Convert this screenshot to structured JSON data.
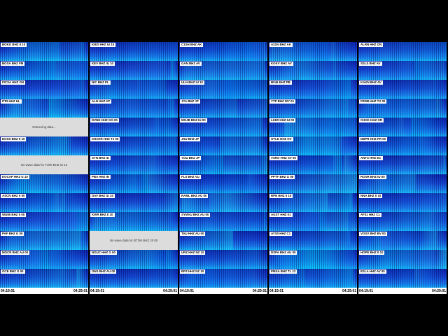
{
  "colors": {
    "background": "#000000",
    "spec_low": "#0d1fa8",
    "spec_high": "#18b8ff",
    "no_data": "#dcdcdc"
  },
  "columns": [
    {
      "stations": [
        {
          "label": "BOKG BHZ II 10"
        },
        {
          "label": "BOSA BHZ FM"
        },
        {
          "label": "FICSA HHZ ON"
        },
        {
          "label": "ITIR HHZ HL"
        },
        {
          "label": "",
          "message": "Retrieving data..."
        },
        {
          "label": "DOSS BHZ II 10"
        },
        {
          "label": "",
          "message": "No wave data for FURI BHZ IU 10"
        },
        {
          "label": "KOCAP HHZ G 10"
        },
        {
          "label": "ASCN BHZ II 00"
        },
        {
          "label": "WUMI BHZ II 00"
        },
        {
          "label": "PAF BHZ G 00"
        },
        {
          "label": "MOCR BHZ AU 00"
        },
        {
          "label": "OCE BHZ G 00"
        }
      ],
      "time_start": "04:19:01",
      "time_end": "04:29:01"
    },
    {
      "stations": [
        {
          "label": "KIES HHZ IU 10"
        },
        {
          "label": "KEV BHZ IU 10"
        },
        {
          "label": "NIC BHZ PL"
        },
        {
          "label": "ALN HHZ HT"
        },
        {
          "label": "DVNH HHZ GO 00"
        },
        {
          "label": "SHAHR HHZ TJ 00"
        },
        {
          "label": "SYN BHZ IU"
        },
        {
          "label": "PBA HHZ IN"
        },
        {
          "label": "DAV BHZ IU 10"
        },
        {
          "label": "KWR BHZ II 10"
        },
        {
          "label": "",
          "message": "No wave data for BTDH BHZ 20 00"
        },
        {
          "label": "NOUC HHZ G 00"
        },
        {
          "label": "ONS BHZ AU 00"
        }
      ],
      "time_start": "04:19:01",
      "time_end": "04:29:01"
    },
    {
      "stations": [
        {
          "label": "C1SH BHZ AK"
        },
        {
          "label": "GAN BHZ AV"
        },
        {
          "label": "ULN BHZ IU 10"
        },
        {
          "label": "JYA BHZ JP"
        },
        {
          "label": "MOJB BHZ IU 00"
        },
        {
          "label": "JSU BHZ JP"
        },
        {
          "label": "YOU BHZ JP"
        },
        {
          "label": "FLS BHZ VU"
        },
        {
          "label": "RAML BHZ AU 00"
        },
        {
          "label": "SYMVU BHZ AU 00"
        },
        {
          "label": "TAU HHZ AU 00"
        },
        {
          "label": "URZ HHZ NZ 10"
        },
        {
          "label": "RPZ HHZ NZ 10"
        }
      ],
      "time_start": "04:19:01",
      "time_end": "04:29:01"
    },
    {
      "stations": [
        {
          "label": "A21N BHZ AK"
        },
        {
          "label": "KOKV BHZ AV"
        },
        {
          "label": "B046 EHZ PB"
        },
        {
          "label": "YTP BHZ WY 01"
        },
        {
          "label": "LIHW HHZ IU 00"
        },
        {
          "label": "OTLD HHZ HV"
        },
        {
          "label": "VSRO HHZ SV 00"
        },
        {
          "label": "PPTF BHZ G 00"
        },
        {
          "label": "RPN BHZ II 10"
        },
        {
          "label": "AGST HHZ 01"
        },
        {
          "label": "AYS0 HHZ C1"
        },
        {
          "label": "DSPA BHZ AU 00"
        },
        {
          "label": "PMSA BHZ TL 12"
        }
      ],
      "time_start": "04:19:01",
      "time_end": "04:29:01"
    },
    {
      "stations": [
        {
          "label": "ALRN HHZ ON"
        },
        {
          "label": "SSLS BHZ AV"
        },
        {
          "label": "KAKN BHZ AV"
        },
        {
          "label": "FRDB HHZ TX 00"
        },
        {
          "label": "CHOK HHZ OR"
        },
        {
          "label": "DBPR HHZ PR 00"
        },
        {
          "label": "ANTS HHZ EC"
        },
        {
          "label": "ROSR BHZ IU 00"
        },
        {
          "label": "NNA BHZ II 10"
        },
        {
          "label": "AF31 HHZ C1"
        },
        {
          "label": "VOSV BHZ BV 00"
        },
        {
          "label": "HOPE BHZ II 10"
        },
        {
          "label": "ESLA HHZ AV 00"
        }
      ],
      "time_start": "04:19:01",
      "time_end": "04:29:01"
    }
  ]
}
